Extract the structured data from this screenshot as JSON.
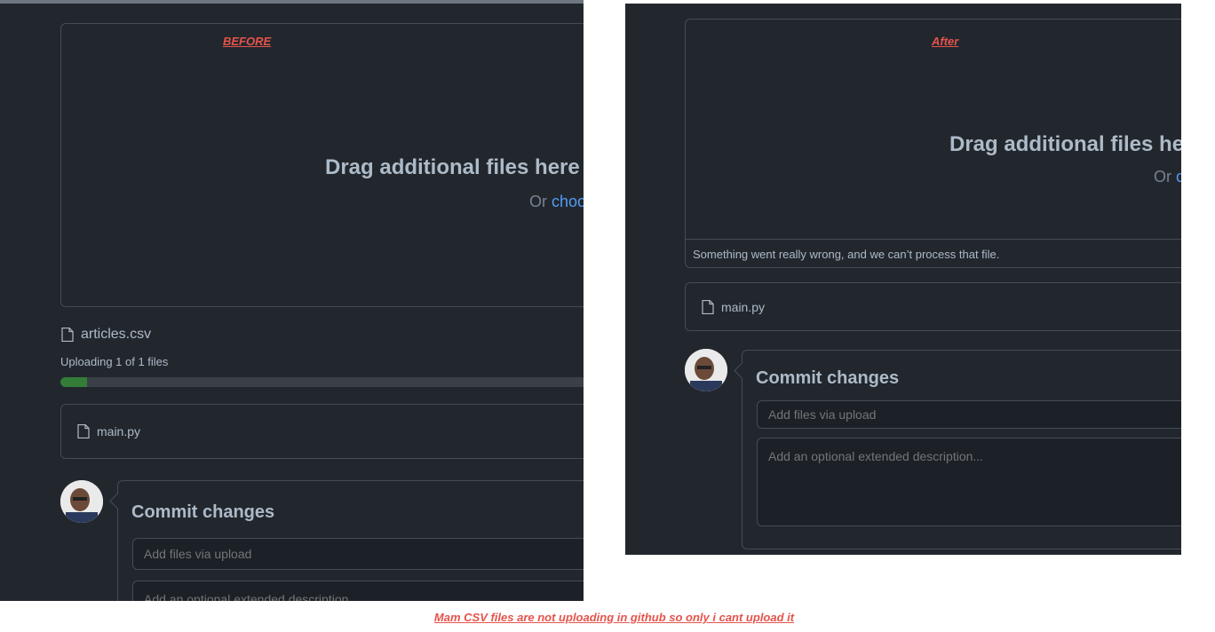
{
  "before": {
    "label": "BEFORE",
    "dropzone": {
      "title": "Drag additional files here t",
      "sub_prefix": "Or ",
      "sub_link": "choo"
    },
    "uploading_file": "articles.csv",
    "upload_status": "Uploading 1 of 1 files",
    "upload_progress": 0.05,
    "existing_file": "main.py",
    "commit": {
      "title": "Commit changes",
      "summary_placeholder": "Add files via upload",
      "description_placeholder": "Add an optional extended description..."
    }
  },
  "after": {
    "label": "After",
    "dropzone": {
      "title": "Drag additional files her",
      "sub_prefix": "Or ",
      "sub_link": "c"
    },
    "error_message": "Something went really wrong, and we can’t process that file.",
    "existing_file": "main.py",
    "commit": {
      "title": "Commit changes",
      "summary_placeholder": "Add files via upload",
      "description_placeholder": "Add an optional extended description..."
    }
  },
  "caption": "Mam CSV files are not uploading in github so only i cant upload it",
  "colors": {
    "background": "#22272e",
    "border": "#444c56",
    "link": "#539bf5",
    "progress": "#347d39",
    "annotation": "#e5534b"
  },
  "icons": [
    "file-icon",
    "avatar"
  ]
}
